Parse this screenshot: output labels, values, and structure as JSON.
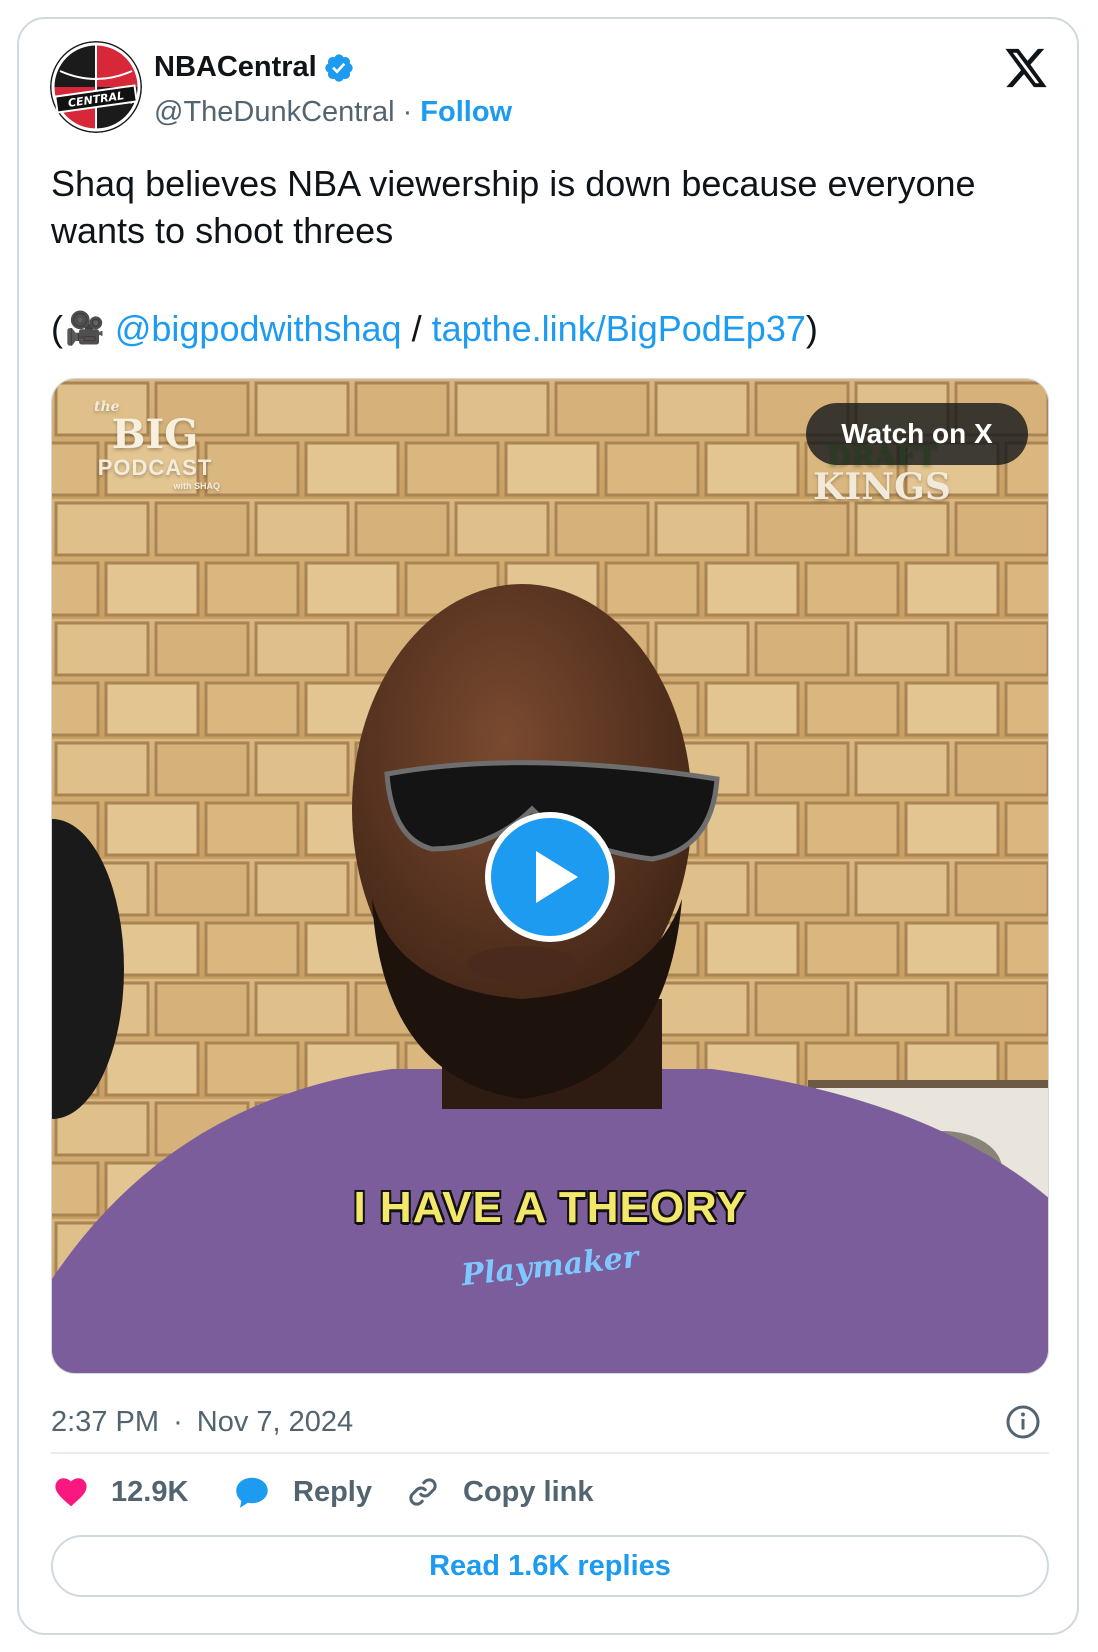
{
  "author": {
    "name": "NBACentral",
    "handle": "@TheDunkCentral",
    "separator": "·",
    "follow_label": "Follow",
    "verified": true,
    "avatar_text": "CENTRAL"
  },
  "tweet": {
    "text": "Shaq believes NBA viewership is down because everyone wants to shoot threes",
    "open_paren": "(",
    "camera_emoji": "🎥",
    "mention": "@bigpodwithshaq",
    "slash": "/",
    "link": "tapthe.link/BigPodEp37",
    "close_paren": ")"
  },
  "media": {
    "watch_label": "Watch on X",
    "caption": "I HAVE A THEORY",
    "podcast_logo_script": "the",
    "podcast_logo_big": "BIG",
    "podcast_logo_sub": "PODCAST",
    "podcast_logo_with": "with SHAQ",
    "sponsor_top": "DRAFT",
    "sponsor_bottom": "KINGS",
    "shirt_text": "Playmaker"
  },
  "meta": {
    "time": "2:37 PM",
    "separator": "·",
    "date": "Nov 7, 2024"
  },
  "actions": {
    "likes": "12.9K",
    "reply_label": "Reply",
    "copy_label": "Copy link",
    "read_replies": "Read 1.6K replies"
  },
  "colors": {
    "accent": "#1d9bf0",
    "like": "#f91880",
    "muted": "#536471",
    "text": "#0f1419"
  }
}
